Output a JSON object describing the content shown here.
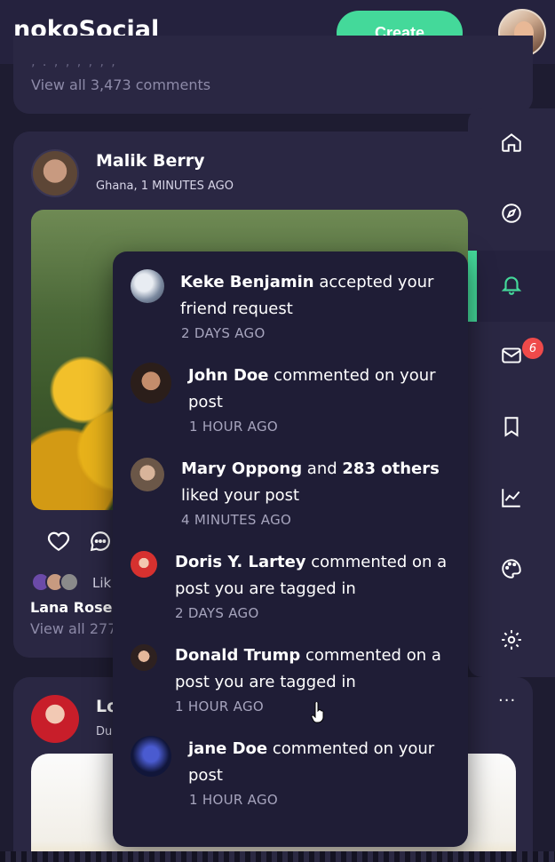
{
  "app": {
    "name": "nokoSocial"
  },
  "header": {
    "create_label": "Create"
  },
  "feed": {
    "prev_post": {
      "view_comments": "View all 3,473 comments"
    },
    "post1": {
      "author": "Malik Berry",
      "meta": "Ghana, 1 MINUTES AGO",
      "likes_prefix": "Lik",
      "liked_by": "Lana Rose",
      "view_comments": "View all 277"
    },
    "post2": {
      "author_partial": "Lo",
      "meta_partial": "Du",
      "more": "···"
    }
  },
  "sidebar": {
    "items": [
      "home-icon",
      "compass-icon",
      "bell-icon",
      "mail-icon",
      "bookmark-icon",
      "chart-icon",
      "palette-icon",
      "settings-icon"
    ],
    "active": "bell-icon",
    "messages_badge": "6",
    "accent": "#44d99a"
  },
  "notifications": [
    {
      "name": "Keke Benjamin",
      "action": " accepted your friend request",
      "time": "2 DAYS AGO"
    },
    {
      "name": "John Doe",
      "action": " commented on your post",
      "time": "1 HOUR AGO"
    },
    {
      "name": "Mary Oppong",
      "mid": " and ",
      "name2": "283 others",
      "action": " liked your post",
      "time": "4 MINUTES AGO"
    },
    {
      "name": "Doris Y. Lartey",
      "action": " commented on a post you are tagged in",
      "time": "2 DAYS AGO"
    },
    {
      "name": "Donald Trump",
      "action": " commented on a post you are tagged in",
      "time": "1 HOUR AGO"
    },
    {
      "name": "jane Doe",
      "action": " commented on your post",
      "time": "1 HOUR AGO"
    }
  ]
}
